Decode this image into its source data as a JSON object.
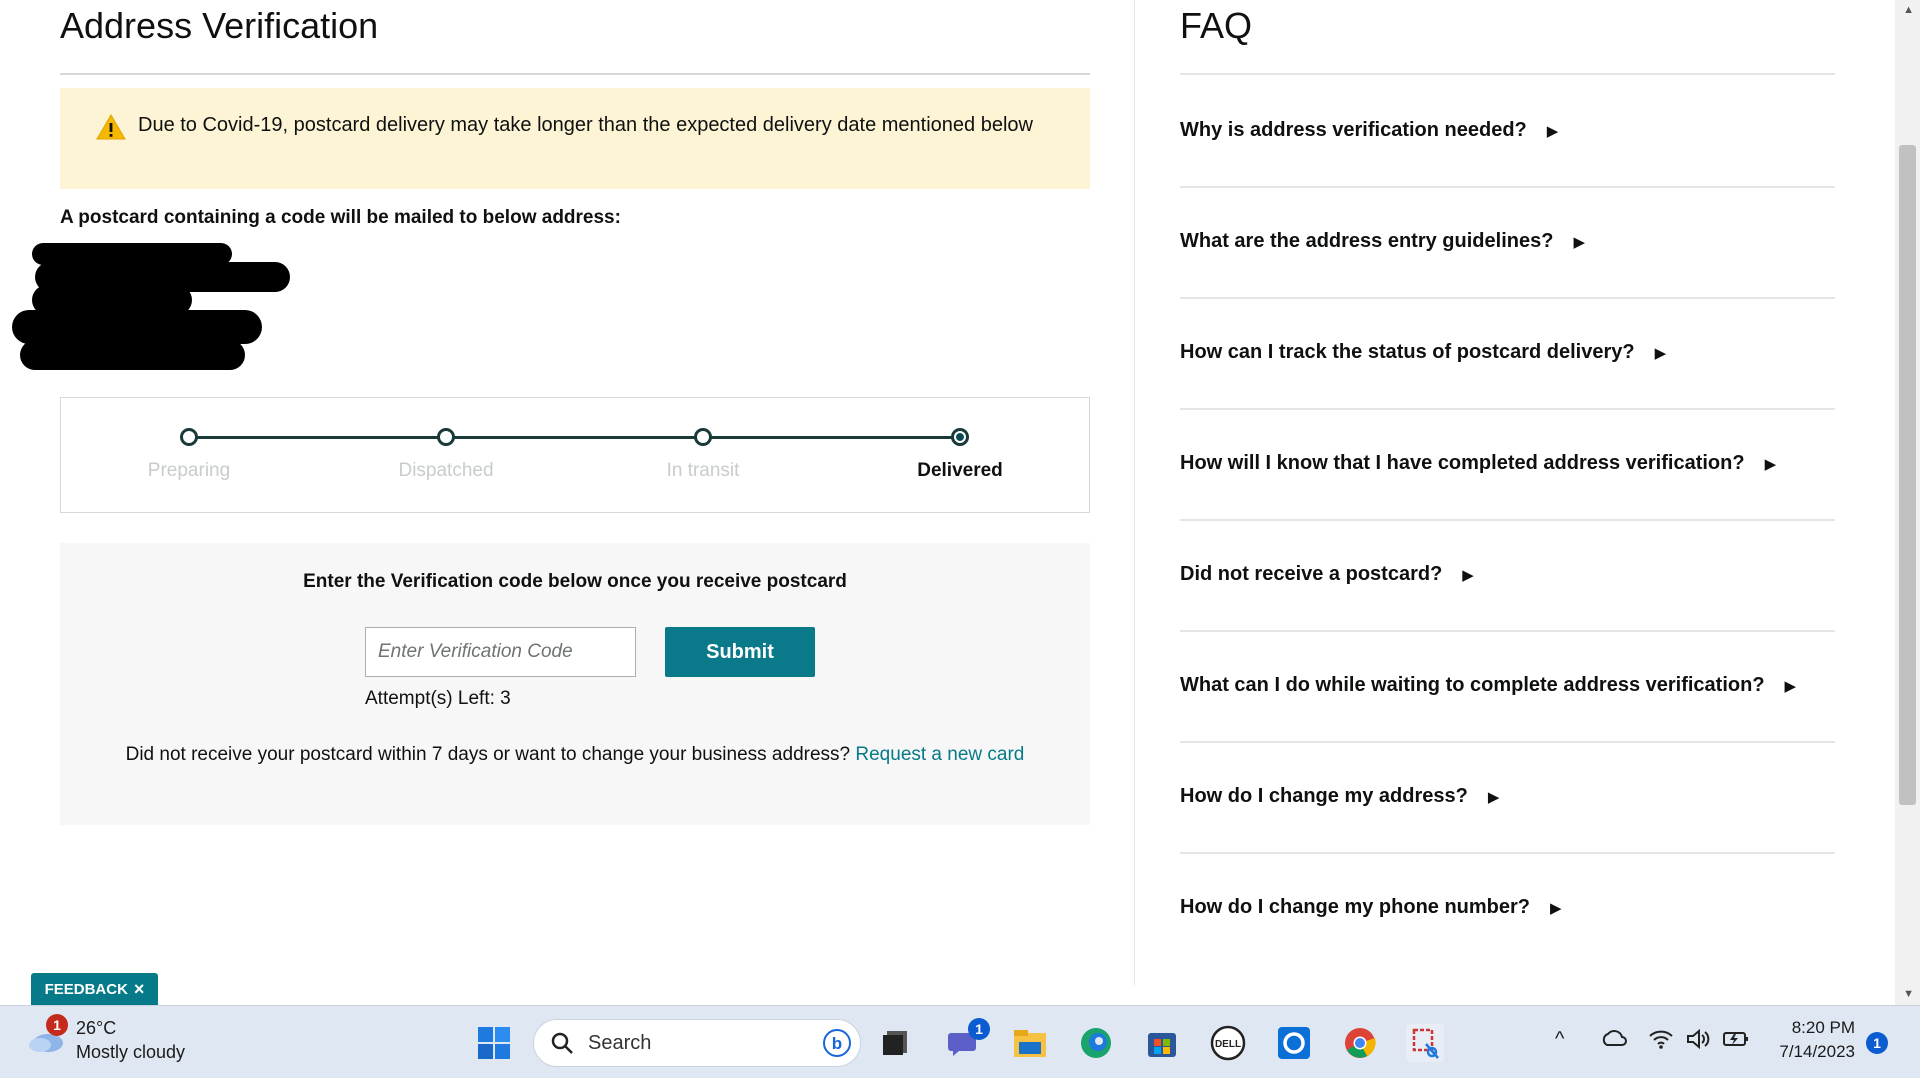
{
  "left": {
    "title": "Address Verification",
    "alert_text": "Due to Covid-19, postcard delivery may take longer than the expected delivery date mentioned below",
    "mail_heading": "A postcard containing a code will be mailed to below address:",
    "steps": [
      "Preparing",
      "Dispatched",
      "In transit",
      "Delivered"
    ],
    "active_step": "Delivered",
    "verify": {
      "heading": "Enter the Verification code below once you receive postcard",
      "placeholder": "Enter Verification Code",
      "submit_label": "Submit",
      "attempts": "Attempt(s) Left: 3",
      "resend_text": "Did not receive your postcard within 7 days or want to change your business address?",
      "resend_link": "Request a new card"
    },
    "feedback_label": "FEEDBACK",
    "feedback_close": "×"
  },
  "faq": {
    "title": "FAQ",
    "items": [
      "Why is address verification needed?",
      "What are the address entry guidelines?",
      "How can I track the status of postcard delivery?",
      "How will I know that I have completed address verification?",
      "Did not receive a postcard?",
      "What can I do while waiting to complete address verification?",
      "How do I change my address?",
      "How do I change my phone number?"
    ],
    "expand_glyph": "▶"
  },
  "taskbar": {
    "weather_temp": "26°C",
    "weather_desc": "Mostly cloudy",
    "weather_badge": "1",
    "search_label": "Search",
    "teams_badge": "1",
    "time": "8:20 PM",
    "date": "7/14/2023",
    "notification_count": "1",
    "icons": [
      "windows-start-icon",
      "search-icon",
      "bing-icon",
      "task-view-icon",
      "teams-chat-icon",
      "file-explorer-icon",
      "edge-icon",
      "microsoft-store-icon",
      "dell-icon",
      "cortana-icon",
      "chrome-icon",
      "snipping-tool-icon",
      "chevron-up-icon",
      "onedrive-icon",
      "wifi-icon",
      "volume-icon",
      "battery-icon"
    ]
  },
  "colors": {
    "accent": "#077a8a",
    "alert_bg": "#fcf4d4",
    "warning": "#f5b800"
  }
}
